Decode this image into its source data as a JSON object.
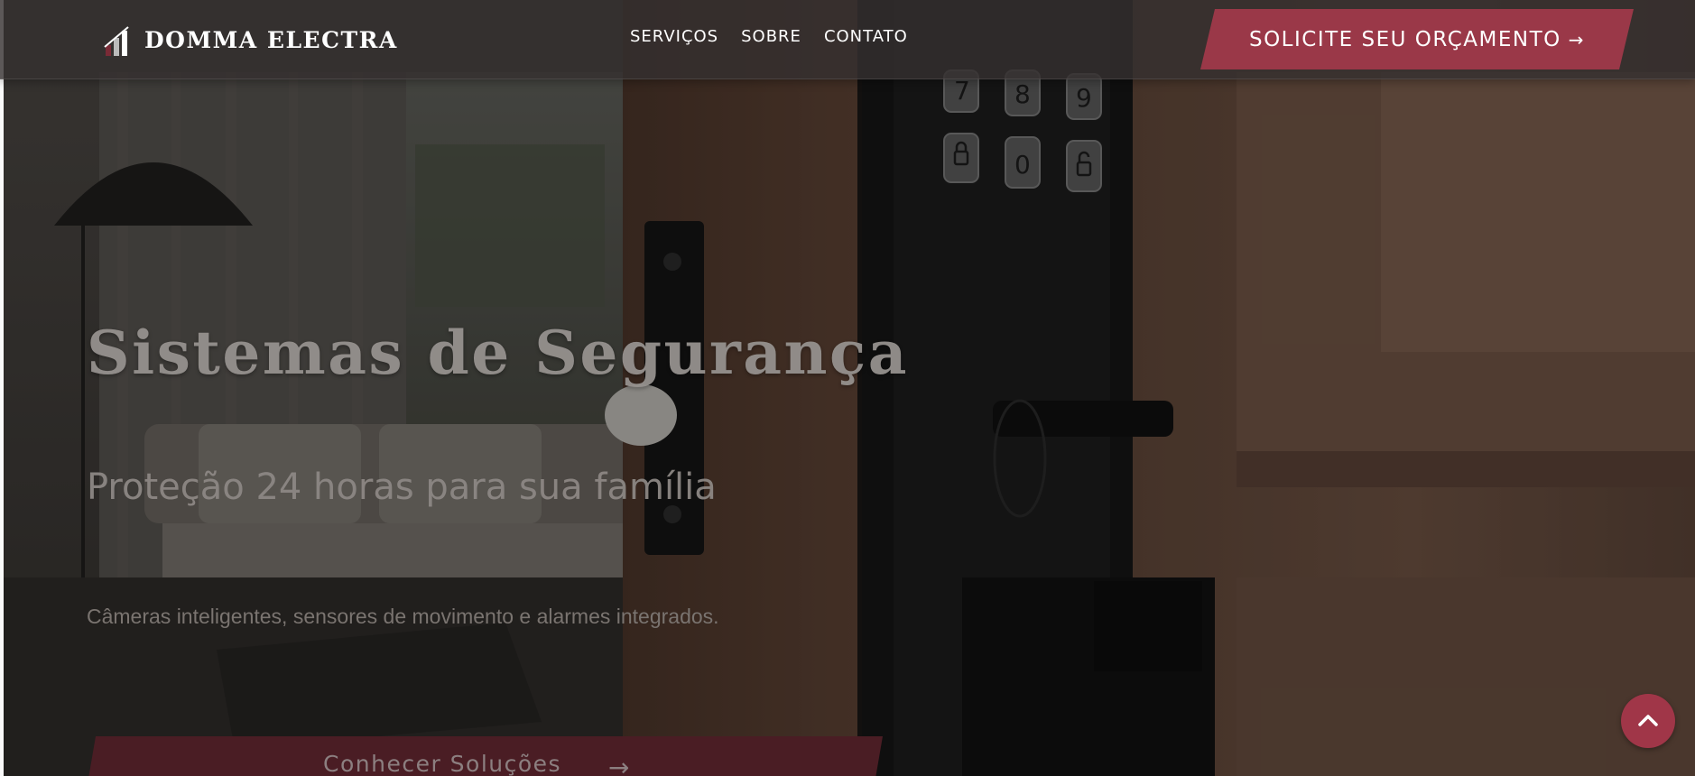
{
  "header": {
    "brand": "DOMMA ELECTRA",
    "nav": [
      {
        "label": "SERVIÇOS"
      },
      {
        "label": "SOBRE"
      },
      {
        "label": "CONTATO"
      }
    ],
    "cta_label": "SOLICITE SEU ORÇAMENTO",
    "cta_arrow": "→"
  },
  "hero": {
    "title": "Sistemas de Segurança",
    "subtitle": "Proteção 24 horas para sua família",
    "description": "Câmeras inteligentes, sensores de movimento e alarmes integrados.",
    "button_label": "Conhecer Soluções",
    "button_arrow": "→",
    "keypad_keys": [
      "7",
      "8",
      "9",
      "0"
    ]
  },
  "colors": {
    "accent": "#9a3848",
    "header_bg": "#343030",
    "scroll_top_bg": "#a03648"
  },
  "icons": {
    "logo": "building-bars-icon",
    "scroll_top": "chevron-up-icon"
  }
}
